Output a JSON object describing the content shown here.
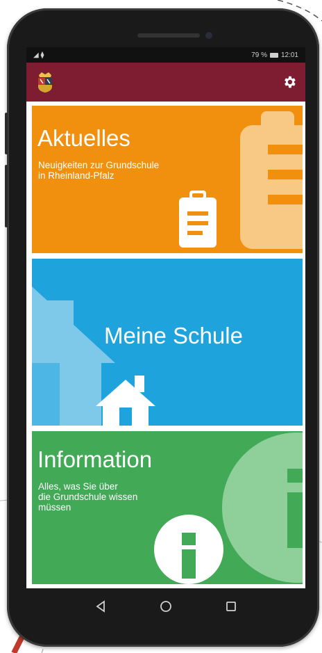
{
  "status_bar": {
    "signal": "◢ ⧫",
    "battery_percent": "79 %",
    "time": "12:01"
  },
  "app_bar": {
    "logo_icon": "rheinland-pfalz-coat-of-arms-icon",
    "settings_icon": "gear-icon"
  },
  "tiles": {
    "aktuelles": {
      "title": "Aktuelles",
      "subtitle": "Neuigkeiten zur Grundschule\nin Rheinland-Pfalz",
      "icon": "clipboard-icon",
      "color": "#f0900e"
    },
    "schule": {
      "title": "Meine Schule",
      "icon": "house-icon",
      "color": "#1ea3dd"
    },
    "info": {
      "title": "Information",
      "subtitle": "Alles, was Sie über\ndie Grundschule wissen\nmüssen",
      "icon": "info-icon",
      "color": "#42a957"
    }
  },
  "nav": {
    "back_icon": "back-triangle-icon",
    "home_icon": "home-circle-icon",
    "recents_icon": "recents-square-icon"
  },
  "colors": {
    "app_bar": "#7e1d32",
    "phone_body": "#1a1a1a"
  }
}
